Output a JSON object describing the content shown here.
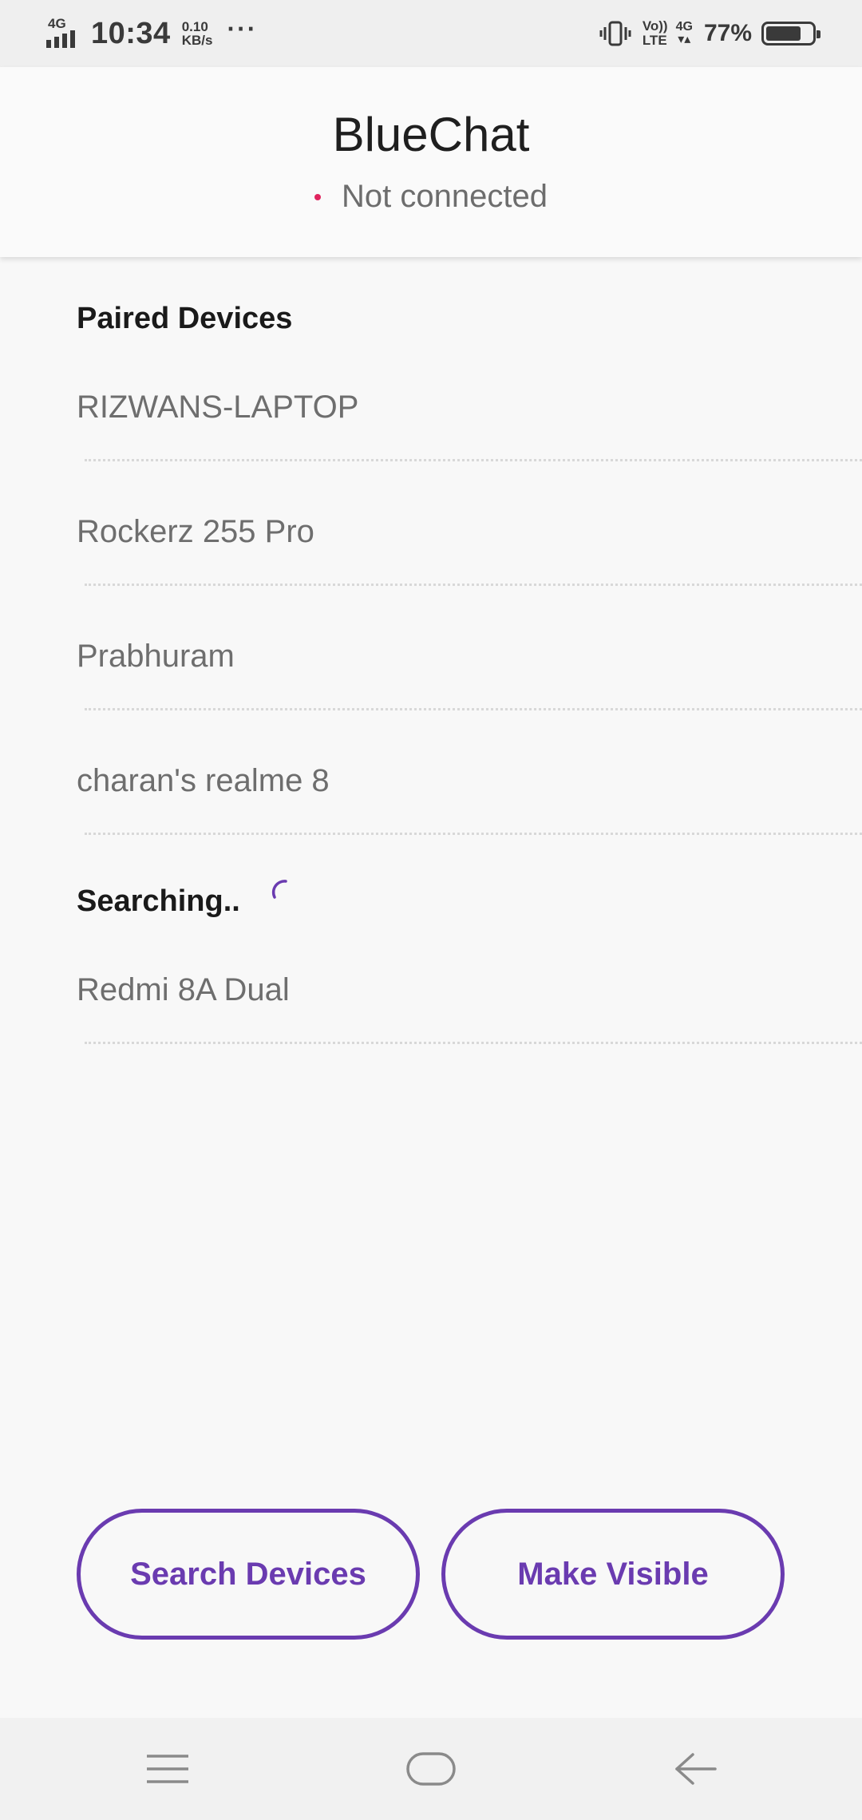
{
  "status_bar": {
    "network_tag": "4G",
    "time": "10:34",
    "speed_value": "0.10",
    "speed_unit": "KB/s",
    "more": "···",
    "volte_top": "Vo))",
    "volte_bottom": "LTE",
    "net_type": "4G",
    "net_arrows": "▾▴",
    "battery_percent": "77%",
    "battery_level": 0.77
  },
  "header": {
    "title": "BlueChat",
    "connection_status": "Not connected",
    "status_dot_color": "#e0245e"
  },
  "paired_devices": {
    "title": "Paired Devices",
    "items": [
      {
        "name": "RIZWANS-LAPTOP"
      },
      {
        "name": "Rockerz 255 Pro"
      },
      {
        "name": "Prabhuram"
      },
      {
        "name": "charan's realme 8"
      }
    ]
  },
  "searching": {
    "title": "Searching..",
    "items": [
      {
        "name": "Redmi 8A Dual"
      }
    ]
  },
  "actions": {
    "search_label": "Search Devices",
    "visible_label": "Make Visible"
  },
  "colors": {
    "accent": "#6a3bb0",
    "status_dot": "#e0245e"
  },
  "nav_icons": [
    "menu-icon",
    "home-icon",
    "back-icon"
  ]
}
